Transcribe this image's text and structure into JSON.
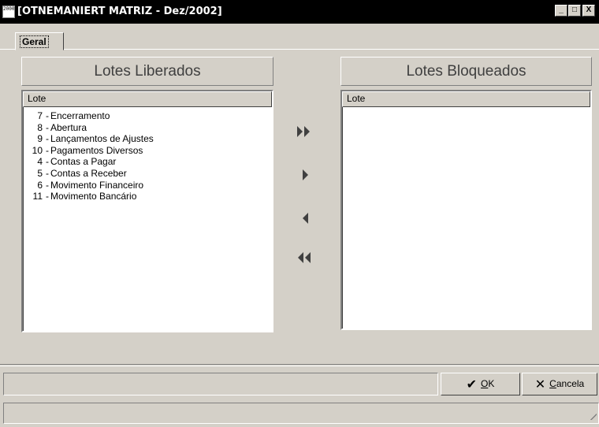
{
  "window": {
    "icon_text": "2000",
    "title": "[OTNEMANIERT MATRIZ - Dez/2002]",
    "minimize_label": "_",
    "maximize_label": "□",
    "close_label": "X"
  },
  "tabs": [
    {
      "label": "Geral",
      "active": true
    }
  ],
  "left_panel": {
    "title": "Lotes Liberados",
    "column_header": "Lote",
    "items": [
      {
        "num": "7",
        "name": "Encerramento"
      },
      {
        "num": "8",
        "name": "Abertura"
      },
      {
        "num": "9",
        "name": "Lançamentos de Ajustes"
      },
      {
        "num": "10",
        "name": "Pagamentos Diversos"
      },
      {
        "num": "4",
        "name": "Contas a Pagar"
      },
      {
        "num": "5",
        "name": "Contas a Receber"
      },
      {
        "num": "6",
        "name": "Movimento Financeiro"
      },
      {
        "num": "11",
        "name": "Movimento Bancário"
      }
    ],
    "separator": "-"
  },
  "right_panel": {
    "title": "Lotes Bloqueados",
    "column_header": "Lote",
    "items": []
  },
  "transfer_buttons": [
    {
      "name": "move-all-right",
      "icon": "double-arrow-right-icon"
    },
    {
      "name": "move-right",
      "icon": "arrow-right-icon"
    },
    {
      "name": "move-left",
      "icon": "arrow-left-icon"
    },
    {
      "name": "move-all-left",
      "icon": "double-arrow-left-icon"
    }
  ],
  "buttons": {
    "ok": {
      "mnemonic": "O",
      "rest": "K",
      "icon": "checkmark-icon"
    },
    "cancel": {
      "mnemonic": "C",
      "rest": "ancela",
      "icon": "x-icon"
    }
  },
  "colors": {
    "window_bg": "#d4d0c8",
    "titlebar_bg": "#000000",
    "arrow_fill": "#404040",
    "list_bg": "#ffffff"
  }
}
